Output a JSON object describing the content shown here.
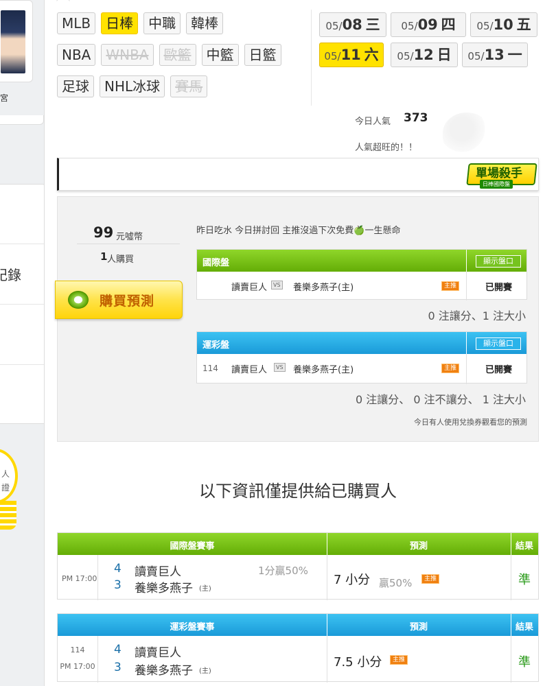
{
  "sidebar": {
    "avatar_caption": "宮",
    "menu_record": "記錄",
    "bulb_text_1": "人",
    "bulb_text_2": "證"
  },
  "sports": {
    "row1": [
      {
        "label": "MLB",
        "state": "normal"
      },
      {
        "label": "日棒",
        "state": "active"
      },
      {
        "label": "中職",
        "state": "normal"
      },
      {
        "label": "韓棒",
        "state": "normal"
      }
    ],
    "row2": [
      {
        "label": "NBA",
        "state": "normal"
      },
      {
        "label": "WNBA",
        "state": "disabled"
      },
      {
        "label": "歐籃",
        "state": "disabled"
      },
      {
        "label": "中籃",
        "state": "normal"
      },
      {
        "label": "日籃",
        "state": "normal"
      }
    ],
    "row3": [
      {
        "label": "足球",
        "state": "normal"
      },
      {
        "label": "NHL冰球",
        "state": "normal"
      },
      {
        "label": "賽馬",
        "state": "disabled"
      }
    ]
  },
  "dates": [
    {
      "md": "05/",
      "d": "08",
      "wd": "三",
      "active": false
    },
    {
      "md": "05/",
      "d": "09",
      "wd": "四",
      "active": false
    },
    {
      "md": "05/",
      "d": "10",
      "wd": "五",
      "active": false
    },
    {
      "md": "05/",
      "d": "11",
      "wd": "六",
      "active": true
    },
    {
      "md": "05/",
      "d": "12",
      "wd": "日",
      "active": false
    },
    {
      "md": "05/",
      "d": "13",
      "wd": "一",
      "active": false
    }
  ],
  "popularity": {
    "label": "今日人氣",
    "value": "373",
    "note": "人氣超旺的！！"
  },
  "killer_badge": {
    "title": "單場殺手",
    "sub": "日棒國際盤"
  },
  "seller": {
    "price": "99",
    "unit": "元噓幣",
    "buyers_num": "1",
    "buyers_text": "人購買",
    "buy_button": "購買預測"
  },
  "slogan": "昨日吃水 今日拼討回 主推沒過下次免費🍏一生懸命",
  "intl_panel": {
    "title": "國際盤",
    "show_btn": "顯示盤口",
    "game_num": "",
    "away": "讀賣巨人",
    "home": "養樂多燕子(主)",
    "badge": "主推",
    "status": "已開賽",
    "summary": "0 注讓分、1 注大小"
  },
  "lottery_panel": {
    "title": "運彩盤",
    "show_btn": "顯示盤口",
    "game_num": "114",
    "away": "讀賣巨人",
    "home": "養樂多燕子(主)",
    "badge": "主推",
    "status": "已開賽",
    "summary": "0 注讓分、 0 注不讓分、 1 注大小",
    "note": "今日有人使用兌換券觀看您的預測"
  },
  "purchased_heading": "以下資訊僅提供給已購買人",
  "intl_table": {
    "col_game": "國際盤賽事",
    "col_pred": "預測",
    "col_result": "結果",
    "time": "PM 17:00",
    "away_score": "4",
    "away": "讀賣巨人",
    "home_score": "3",
    "home": "養樂多燕子",
    "home_mark": "(主)",
    "line": "1分贏50%",
    "pred_main": "7 小分",
    "pred_sub": "贏50%",
    "badge": "主推",
    "result": "準"
  },
  "lottery_table": {
    "col_game": "運彩盤賽事",
    "col_pred": "預測",
    "col_result": "結果",
    "game_num": "114",
    "time": "PM 17:00",
    "away_score": "4",
    "away": "讀賣巨人",
    "home_score": "3",
    "home": "養樂多燕子",
    "home_mark": "(主)",
    "pred_main": "7.5 小分",
    "badge": "主推",
    "result": "準"
  },
  "colors": {
    "accent_yellow": "#ffe200",
    "green": "#64ad06",
    "blue": "#1a9ad8",
    "badge_orange": "#f08010",
    "win_green": "#2a9a1a"
  }
}
